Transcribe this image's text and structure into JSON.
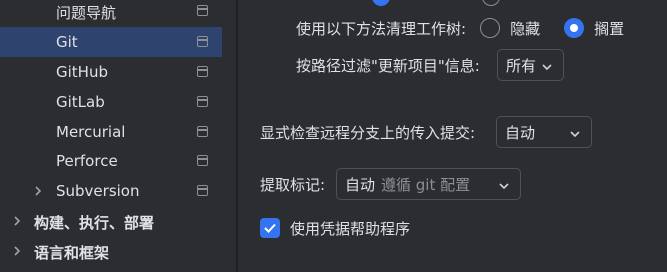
{
  "sidebar": {
    "items": [
      {
        "label": "问题导航",
        "has_arrow": false,
        "bold": false,
        "selected": false
      },
      {
        "label": "Git",
        "has_arrow": false,
        "bold": false,
        "selected": true
      },
      {
        "label": "GitHub",
        "has_arrow": false,
        "bold": false,
        "selected": false
      },
      {
        "label": "GitLab",
        "has_arrow": false,
        "bold": false,
        "selected": false
      },
      {
        "label": "Mercurial",
        "has_arrow": false,
        "bold": false,
        "selected": false
      },
      {
        "label": "Perforce",
        "has_arrow": false,
        "bold": false,
        "selected": false
      },
      {
        "label": "Subversion",
        "has_arrow": true,
        "bold": false,
        "selected": false
      },
      {
        "label": "构建、执行、部署",
        "has_arrow": true,
        "bold": true,
        "selected": false
      },
      {
        "label": "语言和框架",
        "has_arrow": true,
        "bold": true,
        "selected": false
      }
    ]
  },
  "settings": {
    "cleanup_label": "使用以下方法清理工作树:",
    "cleanup_options": [
      {
        "label": "隐藏",
        "selected": false
      },
      {
        "label": "搁置",
        "selected": true
      }
    ],
    "filter_label": "按路径过滤\"更新项目\"信息:",
    "filter_value": "所有",
    "incoming_label": "显式检查远程分支上的传入提交:",
    "incoming_value": "自动",
    "fetch_label": "提取标记:",
    "fetch_value": "自动",
    "fetch_hint": "遵循 git 配置",
    "credential_label": "使用凭据帮助程序",
    "credential_checked": true
  },
  "colors": {
    "accent": "#3574f0",
    "selection": "#2e436e",
    "background": "#2b2d30"
  }
}
